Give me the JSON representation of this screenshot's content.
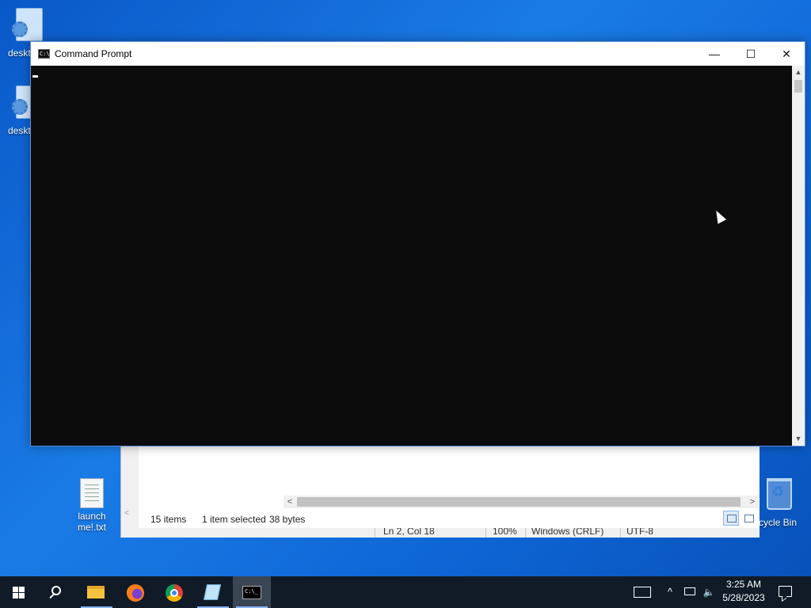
{
  "desktop": {
    "icons": [
      {
        "label": "deskt",
        "icon": "settings-file-icon"
      },
      {
        "label": "deskt",
        "icon": "settings-file-icon"
      },
      {
        "label": "launch me!.txt",
        "line1": "launch",
        "line2": "me!.txt",
        "icon": "text-file-icon"
      },
      {
        "label": "cycle Bin",
        "icon": "recycle-bin-icon"
      }
    ]
  },
  "cmd_window": {
    "title": "Command Prompt",
    "icon_text": "C:\\",
    "minimize": "—",
    "maximize": "☐",
    "close": "✕",
    "scroll_up": "▲",
    "scroll_down": "▼"
  },
  "explorer_window": {
    "item_count": "15 items",
    "selection": "1 item selected",
    "size": "38 bytes",
    "scroll_left": "<",
    "scroll_right": ">"
  },
  "notepad_status": {
    "position": "Ln 2, Col 18",
    "zoom": "100%",
    "line_ending": "Windows (CRLF)",
    "encoding": "UTF-8"
  },
  "taskbar": {
    "apps": [
      {
        "name": "file-explorer",
        "open": true
      },
      {
        "name": "firefox",
        "open": false
      },
      {
        "name": "chrome",
        "open": false
      },
      {
        "name": "notepad",
        "open": true
      },
      {
        "name": "command-prompt",
        "open": true,
        "active": true
      }
    ],
    "cmd_icon_text": "C:\\_",
    "tray": {
      "show_hidden": "^",
      "clock_time": "3:25 AM",
      "clock_date": "5/28/2023"
    }
  }
}
